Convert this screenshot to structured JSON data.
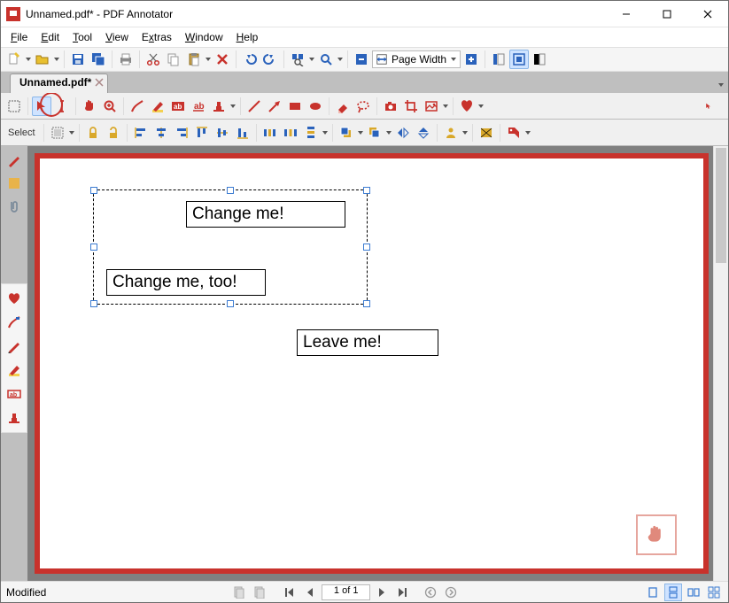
{
  "window": {
    "title": "Unnamed.pdf* - PDF Annotator",
    "minimize": "–",
    "maximize": "□",
    "close": "×"
  },
  "menu": {
    "file": "File",
    "edit": "Edit",
    "tool": "Tool",
    "view": "View",
    "extras": "Extras",
    "window": "Window",
    "help": "Help"
  },
  "toolbar": {
    "zoom_label": "Page Width"
  },
  "tab": {
    "name": "Unnamed.pdf*"
  },
  "anno": {
    "mode_label": "Select"
  },
  "page": {
    "text1": "Change me!",
    "text2": "Change me, too!",
    "text3": "Leave me!"
  },
  "status": {
    "left": "Modified",
    "page": "1 of 1"
  }
}
